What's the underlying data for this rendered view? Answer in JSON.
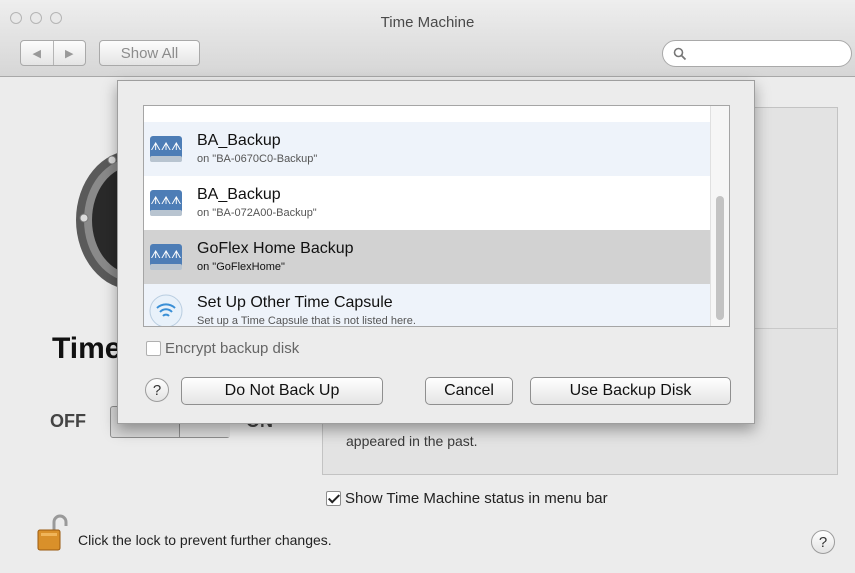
{
  "window": {
    "title": "Time Machine"
  },
  "toolbar": {
    "back_glyph": "◀",
    "forward_glyph": "▶",
    "show_all_label": "Show All",
    "search_placeholder": ""
  },
  "main": {
    "title": "Time Machine",
    "switch": {
      "off_label": "OFF",
      "on_label": "ON",
      "state": "off"
    },
    "description_tail": "appeared in the past.",
    "show_status_label": "Show Time Machine status in menu bar",
    "show_status_checked": true,
    "lock_text": "Click the lock to prevent further changes.",
    "help_glyph": "?"
  },
  "sheet": {
    "disks": [
      {
        "name": "BA_Backup",
        "sub": "on \"BA-0670C0-Backup\"",
        "icon": "network-disk-icon",
        "selected": false
      },
      {
        "name": "BA_Backup",
        "sub": "on \"BA-072A00-Backup\"",
        "icon": "network-disk-icon",
        "selected": false
      },
      {
        "name": "GoFlex Home Backup",
        "sub": "on \"GoFlexHome\"",
        "icon": "network-disk-icon",
        "selected": true
      },
      {
        "name": "Set Up Other Time Capsule",
        "sub": "Set up a Time Capsule that is not listed here.",
        "icon": "wifi-icon",
        "selected": false
      }
    ],
    "encrypt_label": "Encrypt backup disk",
    "encrypt_checked": false,
    "help_glyph": "?",
    "buttons": {
      "do_not_back_up": "Do Not Back Up",
      "cancel": "Cancel",
      "use_backup_disk": "Use Backup Disk"
    }
  },
  "colors": {
    "selection": "#d2d2d2",
    "alt_row": "#eef3fa"
  }
}
